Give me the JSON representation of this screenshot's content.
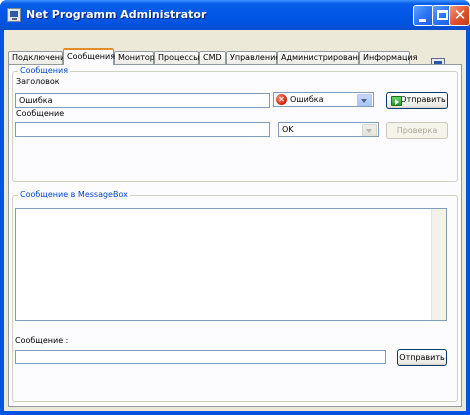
{
  "window": {
    "title": "Net Programm Administrator"
  },
  "tabs": [
    {
      "label": "Подключения"
    },
    {
      "label": "Сообщения"
    },
    {
      "label": "Монитор"
    },
    {
      "label": "Процессы"
    },
    {
      "label": "CMD"
    },
    {
      "label": "Управление"
    },
    {
      "label": "Администрирование"
    },
    {
      "label": "Информация"
    }
  ],
  "messages_group": {
    "caption": "Сообщения",
    "header_label": "Заголовок",
    "header_value": "Ошибка",
    "icon_combo_value": "Ошибка",
    "icon_combo_icon": "error-icon",
    "send_button_label": "Отправить",
    "send_button_icon": "send-icon",
    "message_label": "Сообщение",
    "message_value": "",
    "buttons_combo_value": "OK",
    "check_button_label": "Проверка"
  },
  "messagebox_group": {
    "caption": "Сообщение в MessageBox",
    "message_label": "Сообщение :",
    "message_value": "",
    "send_button_label": "Отправить"
  }
}
